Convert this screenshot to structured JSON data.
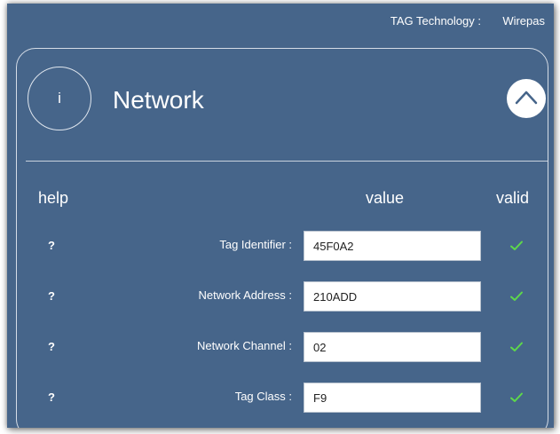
{
  "header": {
    "tech_label": "TAG Technology :",
    "tech_value": "Wirepas"
  },
  "section": {
    "info_icon_glyph": "i",
    "title": "Network",
    "collapse_icon": "chevron-up-icon"
  },
  "columns": {
    "help": "help",
    "value": "value",
    "valid": "valid"
  },
  "rows": [
    {
      "help": "?",
      "label": "Tag Identifier :",
      "value": "45F0A2",
      "valid": true
    },
    {
      "help": "?",
      "label": "Network Address :",
      "value": "210ADD",
      "valid": true
    },
    {
      "help": "?",
      "label": "Network Channel :",
      "value": "02",
      "valid": true
    },
    {
      "help": "?",
      "label": "Tag Class :",
      "value": "F9",
      "valid": true
    }
  ],
  "colors": {
    "background": "#46658a",
    "check": "#5ed94a",
    "text": "#ffffff"
  }
}
